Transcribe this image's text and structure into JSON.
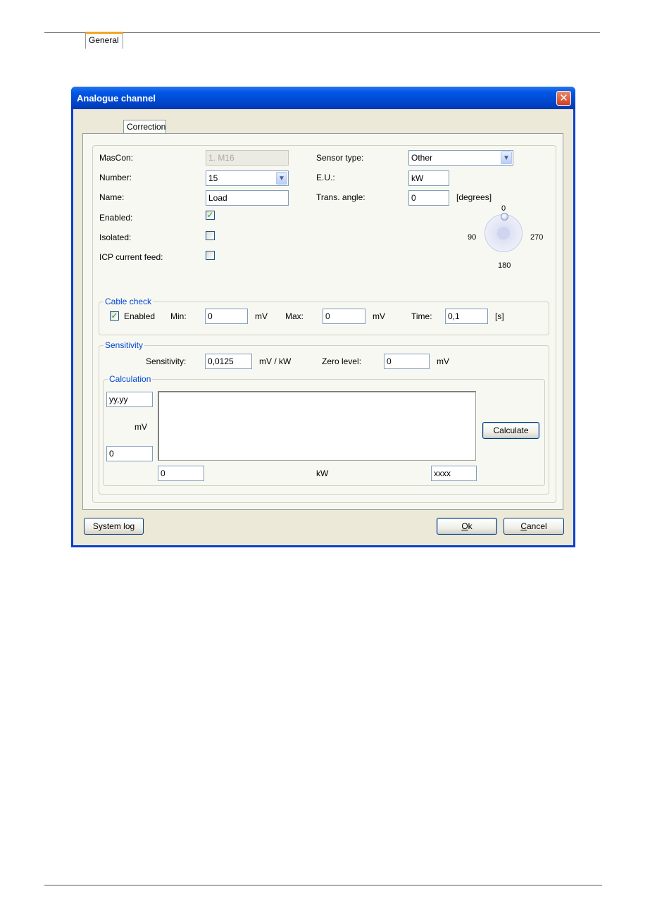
{
  "window": {
    "title": "Analogue channel",
    "close_symbol": "✕"
  },
  "tabs": [
    {
      "label": "General"
    },
    {
      "label": "Correction"
    }
  ],
  "general": {
    "mascon": {
      "label": "MasCon:",
      "value": "1. M16"
    },
    "number": {
      "label": "Number:",
      "value": "15"
    },
    "name": {
      "label": "Name:",
      "value": "Load"
    },
    "enabled": {
      "label": "Enabled:",
      "checked": true
    },
    "isolated": {
      "label": "Isolated:",
      "checked": false
    },
    "icp": {
      "label": "ICP current feed:",
      "checked": false
    },
    "sensor_type": {
      "label": "Sensor type:",
      "value": "Other"
    },
    "eu": {
      "label": "E.U.:",
      "value": "kW"
    },
    "trans_angle": {
      "label": "Trans. angle:",
      "value": "0",
      "unit": "[degrees]"
    },
    "dial": {
      "top": "0",
      "left": "90",
      "right": "270",
      "bottom": "180"
    }
  },
  "cable_check": {
    "legend": "Cable check",
    "enabled_label": "Enabled",
    "enabled_checked": true,
    "min_label": "Min:",
    "min_value": "0",
    "min_unit": "mV",
    "max_label": "Max:",
    "max_value": "0",
    "max_unit": "mV",
    "time_label": "Time:",
    "time_value": "0,1",
    "time_unit": "[s]"
  },
  "sensitivity": {
    "legend": "Sensitivity",
    "label": "Sensitivity:",
    "value": "0,0125",
    "unit": "mV / kW",
    "zero_label": "Zero level:",
    "zero_value": "0",
    "zero_unit": "mV"
  },
  "calculation": {
    "legend": "Calculation",
    "y_top": "yy,yy",
    "y_unit": "mV",
    "y_bottom": "0",
    "x_left": "0",
    "x_unit": "kW",
    "x_right": "xxxx",
    "calculate_label": "Calculate"
  },
  "footer": {
    "system_log": "System log",
    "ok": "Ok",
    "ok_underline": "O",
    "ok_rest": "k",
    "cancel": "Cancel",
    "cancel_underline": "C",
    "cancel_rest": "ancel"
  }
}
